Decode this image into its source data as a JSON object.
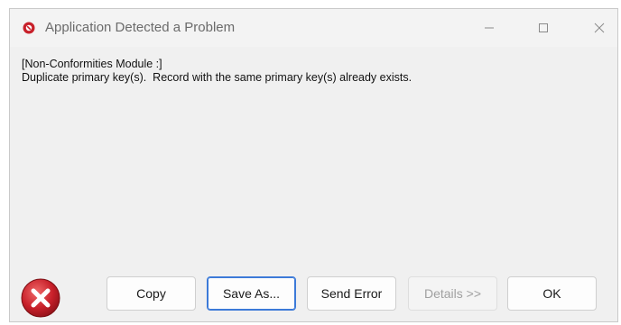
{
  "window": {
    "title": "Application Detected a Problem",
    "controls": {
      "minimize_icon": "minimize-icon",
      "maximize_icon": "maximize-icon",
      "close_icon": "close-icon"
    }
  },
  "message": {
    "line1": "[Non-Conformities Module :]",
    "line2": "Duplicate primary key(s).  Record with the same primary key(s) already exists."
  },
  "buttons": {
    "copy": "Copy",
    "save_as": "Save As...",
    "send_error": "Send Error",
    "details": "Details >>",
    "ok": "OK"
  },
  "colors": {
    "error_red": "#c8202a",
    "focus_blue": "#3c7ad8"
  }
}
